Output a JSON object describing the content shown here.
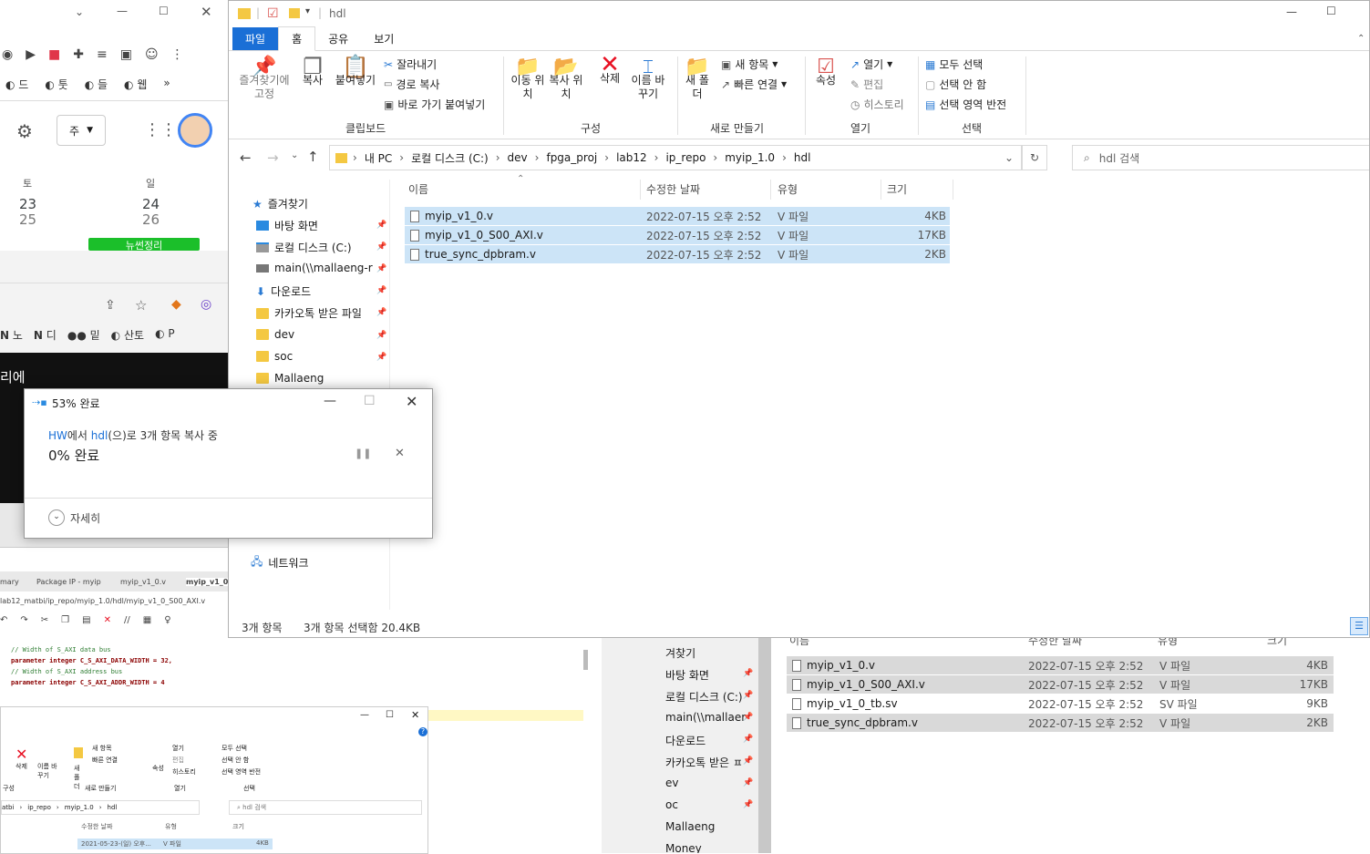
{
  "browser": {
    "bookmarks_row1": [
      "드",
      "툿",
      "들",
      "웹"
    ],
    "account_label": "주",
    "calendar": {
      "days": [
        {
          "weekday": "토",
          "date": "23",
          "sub": "25"
        },
        {
          "weekday": "일",
          "date": "24",
          "sub": "26"
        }
      ],
      "event": "뉴썬정리"
    }
  },
  "browser2": {
    "bookmarks": [
      "노",
      "디",
      "밑",
      "산토",
      "P"
    ],
    "banner": "리에"
  },
  "explorer": {
    "title": "hdl",
    "tabs": [
      "파일",
      "홈",
      "공유",
      "보기"
    ],
    "ribbon": {
      "clipboard": {
        "pin_label": "즐겨찾기에 고정",
        "copy_label": "복사",
        "paste_label": "붙여넣기",
        "cut_label": "잘라내기",
        "copy_path_label": "경로 복사",
        "paste_shortcut_label": "바로 가기 붙여넣기",
        "group_label": "클립보드"
      },
      "organize": {
        "move_label": "이동 위치",
        "copy_to_label": "복사 위치",
        "delete_label": "삭제",
        "rename_label": "이름 바꾸기",
        "group_label": "구성"
      },
      "new": {
        "new_folder_label": "새 폴더",
        "new_item_label": "새 항목",
        "easy_access_label": "빠른 연결",
        "group_label": "새로 만들기"
      },
      "open": {
        "properties_label": "속성",
        "open_label": "열기",
        "edit_label": "편집",
        "history_label": "히스토리",
        "group_label": "열기"
      },
      "select": {
        "select_all_label": "모두 선택",
        "select_none_label": "선택 안 함",
        "invert_label": "선택 영역 반전",
        "group_label": "선택"
      }
    },
    "address": [
      "내 PC",
      "로컬 디스크 (C:)",
      "dev",
      "fpga_proj",
      "lab12",
      "ip_repo",
      "myip_1.0",
      "hdl"
    ],
    "search_placeholder": "hdl 검색",
    "nav": [
      {
        "label": "즐겨찾기"
      },
      {
        "label": "바탕 화면"
      },
      {
        "label": "로컬 디스크 (C:)"
      },
      {
        "label": "main(\\\\mallaeng-r"
      },
      {
        "label": "다운로드"
      },
      {
        "label": "카카오톡 받은 파일"
      },
      {
        "label": "dev"
      },
      {
        "label": "soc"
      },
      {
        "label": "Mallaeng"
      },
      {
        "label": "네트워크"
      }
    ],
    "columns": {
      "name": "이름",
      "modified": "수정한 날짜",
      "type": "유형",
      "size": "크기"
    },
    "files": [
      {
        "name": "myip_v1_0.v",
        "modified": "2022-07-15 오후 2:52",
        "type": "V 파일",
        "size": "4KB"
      },
      {
        "name": "myip_v1_0_S00_AXI.v",
        "modified": "2022-07-15 오후 2:52",
        "type": "V 파일",
        "size": "17KB"
      },
      {
        "name": "true_sync_dpbram.v",
        "modified": "2022-07-15 오후 2:52",
        "type": "V 파일",
        "size": "2KB"
      }
    ],
    "status": {
      "count": "3개 항목",
      "selected": "3개 항목 선택함 20.4KB"
    }
  },
  "dialog": {
    "title": "53% 완료",
    "from": "HW",
    "mid": "에서 ",
    "to": "hdl",
    "rest": "(으)로 3개 항목 복사 중",
    "progress": "0% 완료",
    "details": "자세히"
  },
  "editor": {
    "tabs": [
      "mary",
      "Package IP - myip",
      "myip_v1_0.v",
      "myip_v1_0"
    ],
    "path": "lab12_matbi/ip_repo/myip_1.0/hdl/myip_v1_0_S00_AXI.v",
    "code": [
      {
        "text": "// Width of S_AXI data bus",
        "kind": "comment"
      },
      {
        "text": "parameter integer C_S_AXI_DATA_WIDTH = 32,",
        "kind": "code"
      },
      {
        "text": "// Width of S_AXI address bus",
        "kind": "comment"
      },
      {
        "text": "parameter integer C_S_AXI_ADDR_WIDTH = 4",
        "kind": "code"
      }
    ]
  },
  "mini_explorer": {
    "ribbon": [
      "삭제",
      "이름 바꾸기",
      "새 폴더",
      "새 항목",
      "빠른 연결",
      "속성",
      "열기",
      "편집",
      "히스토리",
      "모두 선택",
      "선택 안 함",
      "선택 영역 반전"
    ],
    "groups": [
      "구성",
      "새로 만들기",
      "열기",
      "선택"
    ],
    "address": [
      "atbi",
      "ip_repo",
      "myip_1.0",
      "hdl"
    ],
    "search": "hdl 검색",
    "cols": [
      "수정한 날짜",
      "유형",
      "크기"
    ],
    "row": {
      "modified": "2021-05-23-(일) 오후...",
      "type": "V 파일",
      "size": "4KB"
    }
  },
  "explorer2": {
    "nav": [
      "겨찾기",
      "바탕 화면",
      "로컬 디스크 (C:)",
      "main(\\\\mallaer",
      "다운로드",
      "카카오톡 받은 ㅍ",
      "ev",
      "oc",
      "Mallaeng",
      "Money"
    ],
    "columns": {
      "name": "이름",
      "modified": "수정한 날짜",
      "type": "유형",
      "size": "크기"
    },
    "files": [
      {
        "name": "myip_v1_0.v",
        "modified": "2022-07-15 오후 2:52",
        "type": "V 파일",
        "size": "4KB",
        "selected": true
      },
      {
        "name": "myip_v1_0_S00_AXI.v",
        "modified": "2022-07-15 오후 2:52",
        "type": "V 파일",
        "size": "17KB",
        "selected": true
      },
      {
        "name": "myip_v1_0_tb.sv",
        "modified": "2022-07-15 오후 2:52",
        "type": "SV 파일",
        "size": "9KB",
        "selected": false
      },
      {
        "name": "true_sync_dpbram.v",
        "modified": "2022-07-15 오후 2:52",
        "type": "V 파일",
        "size": "2KB",
        "selected": true
      }
    ]
  },
  "colors": {
    "accent": "#1a6fd6",
    "selection": "#cce4f7",
    "delete_red": "#e81123"
  }
}
